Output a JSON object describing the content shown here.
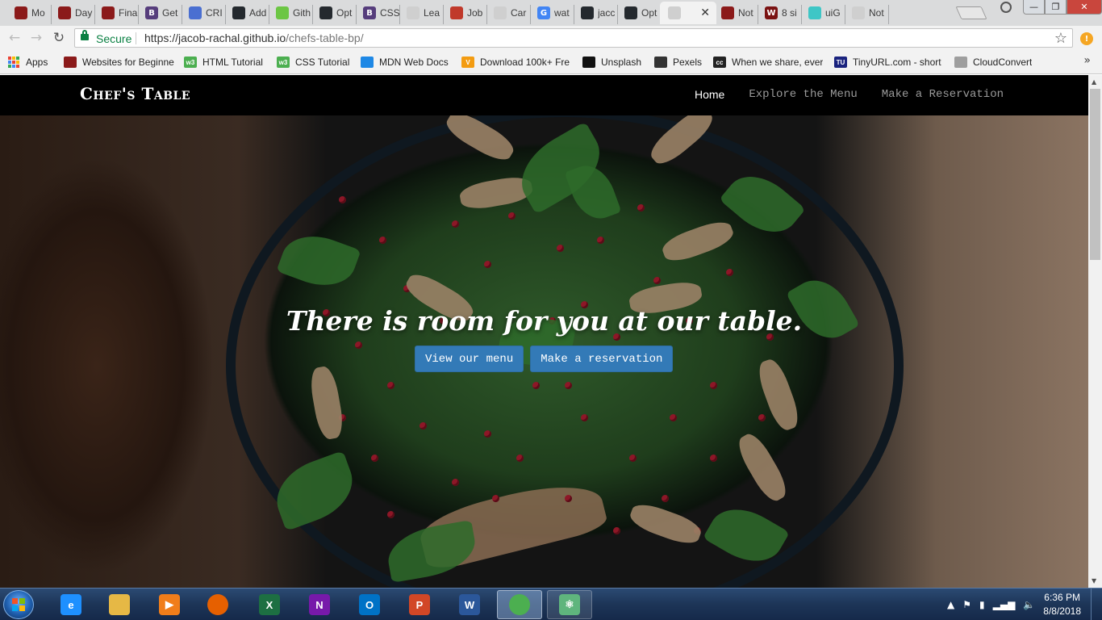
{
  "browser": {
    "tabs": [
      {
        "title": "Mo",
        "icon": "chef-icon",
        "color": "#8b1a1a"
      },
      {
        "title": "Day",
        "icon": "chef-icon",
        "color": "#8b1a1a"
      },
      {
        "title": "Fina",
        "icon": "chef-icon",
        "color": "#8b1a1a"
      },
      {
        "title": "Get",
        "icon": "bootstrap-icon",
        "color": "#563d7c",
        "glyph": "B"
      },
      {
        "title": "CRI",
        "icon": "grid-icon",
        "color": "#4a6fd1"
      },
      {
        "title": "Add",
        "icon": "github-icon",
        "color": "#24292e"
      },
      {
        "title": "Gith",
        "icon": "github-icon",
        "color": "#6cc644"
      },
      {
        "title": "Opt",
        "icon": "github-icon",
        "color": "#24292e"
      },
      {
        "title": "CSS",
        "icon": "bootstrap-icon",
        "color": "#563d7c",
        "glyph": "B"
      },
      {
        "title": "Lea",
        "icon": "document-icon",
        "color": "#cfcfcf"
      },
      {
        "title": "Job",
        "icon": "jobs-icon",
        "color": "#c0392b"
      },
      {
        "title": "Car",
        "icon": "document-icon",
        "color": "#cfcfcf"
      },
      {
        "title": "wat",
        "icon": "google-icon",
        "color": "#4285f4",
        "glyph": "G"
      },
      {
        "title": "jacc",
        "icon": "github-icon",
        "color": "#24292e"
      },
      {
        "title": "Opt",
        "icon": "github-icon",
        "color": "#24292e"
      },
      {
        "title": "",
        "icon": "document-icon",
        "color": "#cfcfcf",
        "active": true
      },
      {
        "title": "Not",
        "icon": "chef-icon",
        "color": "#8b1a1a"
      },
      {
        "title": "8 si",
        "icon": "w-icon",
        "color": "#7a1212",
        "glyph": "W"
      },
      {
        "title": "uiG",
        "icon": "gradient-icon",
        "color": "#3ec6c6"
      },
      {
        "title": "Not",
        "icon": "document-icon",
        "color": "#cfcfcf"
      }
    ],
    "active_tab_close": "✕",
    "window_controls": {
      "minimize": "—",
      "maximize": "❐",
      "close": "✕"
    },
    "secure_label": "Secure",
    "url_host": "https://jacob-rachal.github.io",
    "url_path": "/chefs-table-bp/",
    "bookmarks": [
      {
        "label": "Apps",
        "icon": "apps-icon"
      },
      {
        "label": "Websites for Beginne",
        "icon": "chef-icon",
        "color": "#8b1a1a"
      },
      {
        "label": "HTML Tutorial",
        "icon": "w3-icon",
        "color": "#4caf50",
        "glyph": "w3"
      },
      {
        "label": "CSS Tutorial",
        "icon": "w3-icon",
        "color": "#4caf50",
        "glyph": "w3"
      },
      {
        "label": "MDN Web Docs",
        "icon": "mdn-icon",
        "color": "#1e88e5"
      },
      {
        "label": "Download 100k+ Fre",
        "icon": "v-icon",
        "color": "#f39c12",
        "glyph": "V"
      },
      {
        "label": "Unsplash",
        "icon": "camera-icon",
        "color": "#111111"
      },
      {
        "label": "Pexels",
        "icon": "camera-icon",
        "color": "#333333"
      },
      {
        "label": "When we share, ever",
        "icon": "cc-icon",
        "color": "#222222",
        "glyph": "cc"
      },
      {
        "label": "TinyURL.com - short",
        "icon": "tinyurl-icon",
        "color": "#1a237e",
        "glyph": "TU"
      },
      {
        "label": "CloudConvert",
        "icon": "cloud-icon",
        "color": "#9e9e9e"
      }
    ]
  },
  "site": {
    "brand": "Chef's Table",
    "nav": [
      {
        "label": "Home",
        "active": true
      },
      {
        "label": "Explore the Menu",
        "active": false
      },
      {
        "label": "Make a Reservation",
        "active": false
      }
    ],
    "hero_title": "There is room for you at our table.",
    "buttons": [
      {
        "label": "View our menu"
      },
      {
        "label": "Make a reservation"
      }
    ],
    "accent": "#337ab7"
  },
  "taskbar": {
    "apps": [
      {
        "name": "ie-icon",
        "color": "#1e90ff",
        "glyph": "e"
      },
      {
        "name": "file-explorer-icon",
        "color": "#e6b845",
        "glyph": ""
      },
      {
        "name": "media-player-icon",
        "color": "#f07d1a",
        "glyph": "▶"
      },
      {
        "name": "firefox-icon",
        "color": "#e66000",
        "glyph": ""
      },
      {
        "name": "excel-icon",
        "color": "#1d6f42",
        "glyph": "X"
      },
      {
        "name": "onenote-icon",
        "color": "#7719aa",
        "glyph": "N"
      },
      {
        "name": "outlook-icon",
        "color": "#0072c6",
        "glyph": "O"
      },
      {
        "name": "powerpoint-icon",
        "color": "#d24726",
        "glyph": "P"
      },
      {
        "name": "word-icon",
        "color": "#2b579a",
        "glyph": "W"
      },
      {
        "name": "chrome-icon",
        "color": "#4caf50",
        "glyph": "",
        "active": true
      },
      {
        "name": "atom-icon",
        "color": "#5fb57d",
        "glyph": "⚛",
        "open": true
      }
    ],
    "time": "6:36 PM",
    "date": "8/8/2018"
  }
}
